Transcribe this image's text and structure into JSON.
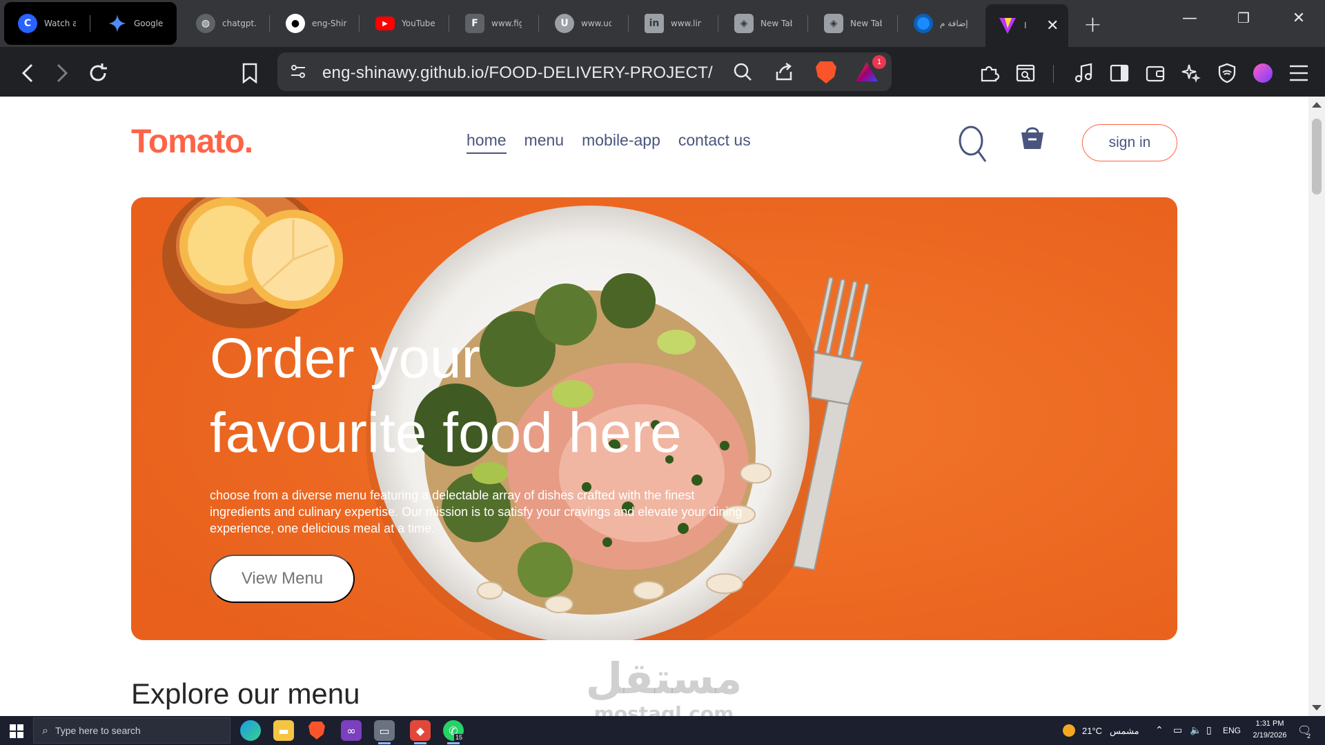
{
  "tabs": [
    {
      "title": "Watch a",
      "icon": "c-logo-icon",
      "color": "#2962ff"
    },
    {
      "title": "Google",
      "icon": "gemini-icon",
      "color": "#4285f4"
    },
    {
      "title": "chatgpt.",
      "icon": "globe-icon",
      "color": "#9aa0a6"
    },
    {
      "title": "eng-Shir",
      "icon": "github-icon",
      "color": "#ffffff"
    },
    {
      "title": "YouTube",
      "icon": "youtube-icon",
      "color": "#ff0000"
    },
    {
      "title": "www.fig",
      "icon": "figma-icon",
      "color": "#9aa0a6"
    },
    {
      "title": "www.ud",
      "icon": "udemy-icon",
      "color": "#9aa0a6"
    },
    {
      "title": "www.lin",
      "icon": "linkedin-icon",
      "color": "#9aa0a6"
    },
    {
      "title": "New Tab",
      "icon": "brave-shield-icon",
      "color": "#9aa0a6"
    },
    {
      "title": "New Tab",
      "icon": "brave-shield-icon",
      "color": "#9aa0a6"
    },
    {
      "title": "إضافة م",
      "icon": "circle-icon",
      "color": "#1a8cff"
    },
    {
      "title": "I",
      "icon": "vite-icon",
      "color": "#bd34fe"
    }
  ],
  "address": {
    "url": "eng-shinawy.github.io/FOOD-DELIVERY-PROJECT/",
    "rewards_badge": "1"
  },
  "site": {
    "logo": "Tomato.",
    "nav": [
      "home",
      "menu",
      "mobile-app",
      "contact us"
    ],
    "active_nav": "home",
    "signin": "sign in",
    "accent": "#ff6347",
    "nav_color": "#49557e"
  },
  "hero": {
    "title_line1": "Order your",
    "title_line2": "favourite food here",
    "description": "choose from a diverse menu featuring a delectable array of dishes crafted with the finest ingredients and culinary expertise. Our mission is to satisfy your cravings and elevate your dining experience, one delicious meal at a time.",
    "button": "View Menu",
    "background": "#f0732a"
  },
  "section": {
    "explore_title": "Explore our menu"
  },
  "watermark": {
    "arabic": "مستقل",
    "latin": "mostaql.com"
  },
  "taskbar": {
    "search_placeholder": "Type here to search",
    "whatsapp_badge": "15",
    "weather": "21°C",
    "weather_desc": "مشمس",
    "language": "ENG",
    "time": "1:31 PM",
    "date": "2/19/2026",
    "notifications": "2"
  }
}
